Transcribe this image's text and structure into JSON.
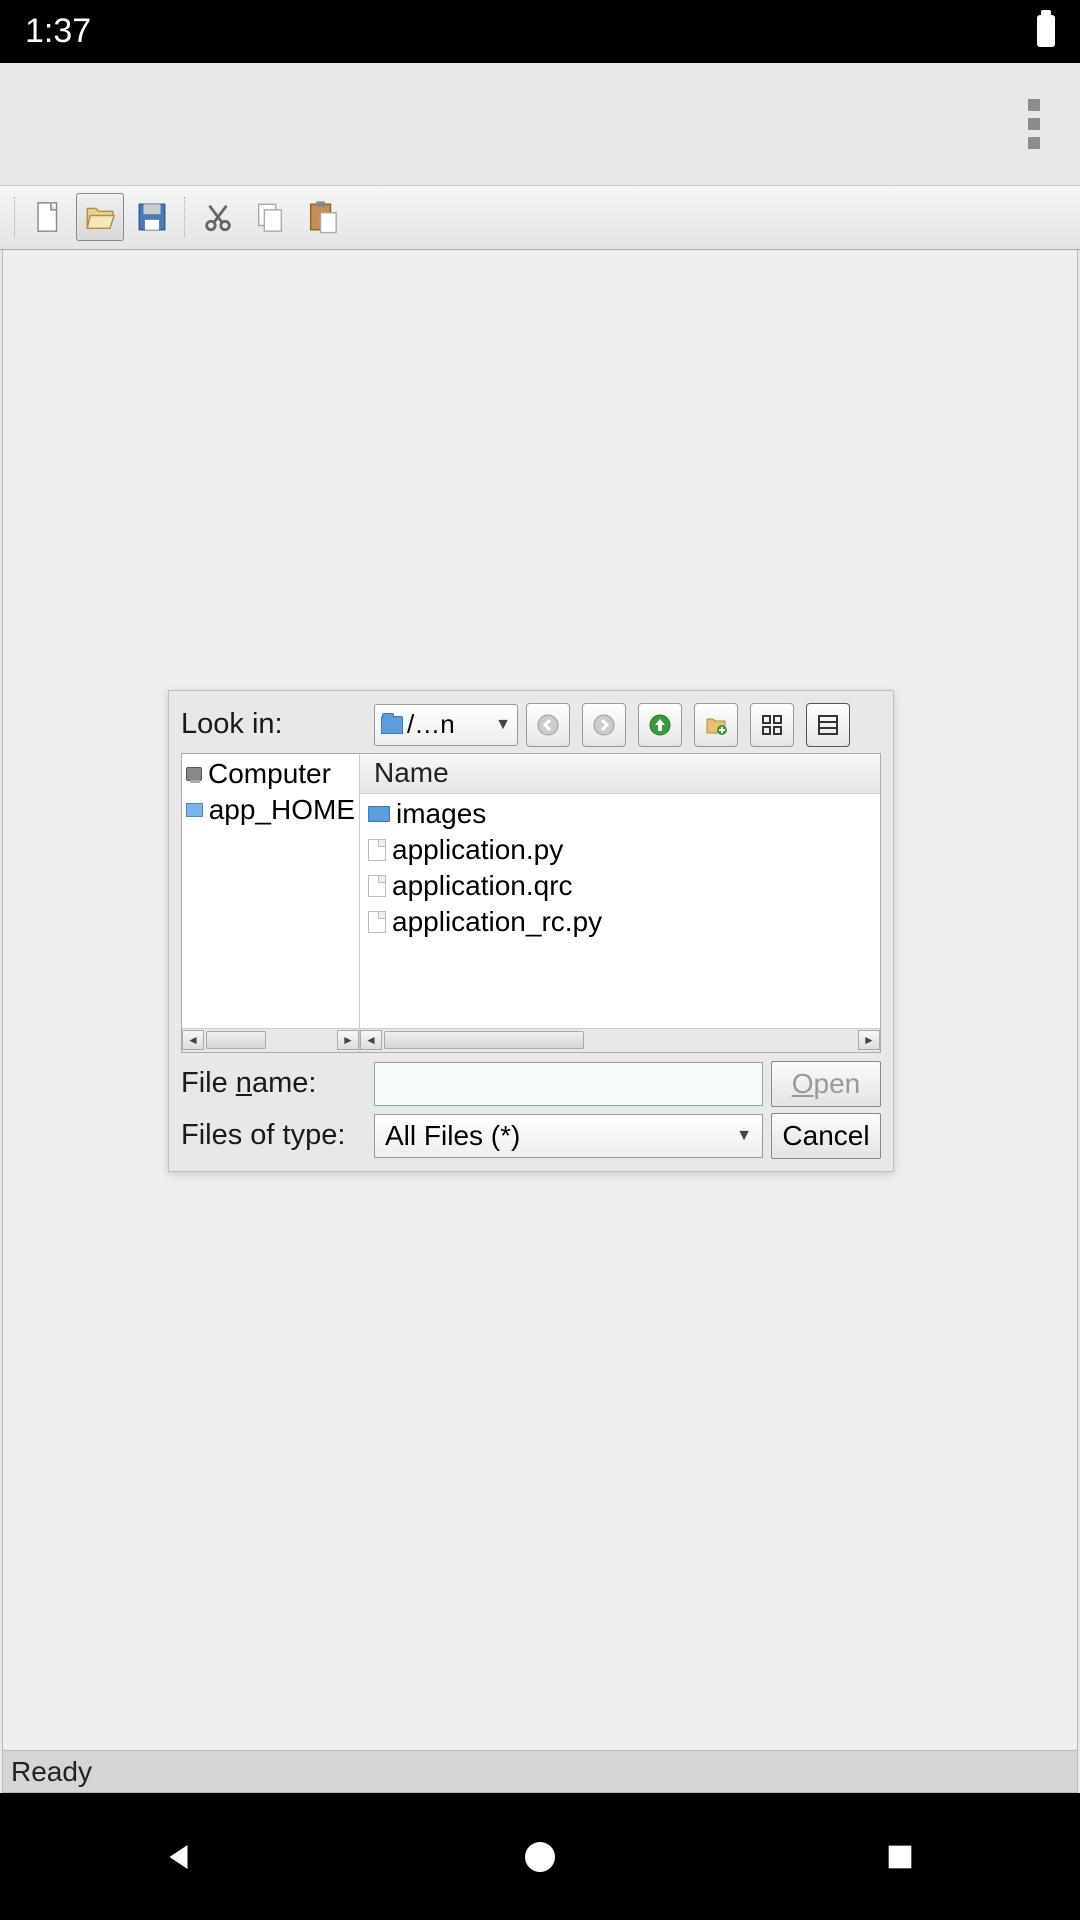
{
  "status_bar": {
    "time": "1:37"
  },
  "toolbar": {
    "buttons": [
      "new",
      "open",
      "save",
      "cut",
      "copy",
      "paste"
    ]
  },
  "dialog": {
    "look_in_label": "Look in:",
    "look_in_value": "/…n",
    "sidebar": [
      "Computer",
      "app_HOME"
    ],
    "column_header": "Name",
    "files": [
      {
        "name": "images",
        "type": "folder"
      },
      {
        "name": "application.py",
        "type": "file"
      },
      {
        "name": "application.qrc",
        "type": "file"
      },
      {
        "name": "application_rc.py",
        "type": "file"
      }
    ],
    "file_name_label_pre": "File ",
    "file_name_label_u": "n",
    "file_name_label_post": "ame:",
    "file_name_value": "",
    "files_of_type_label": "Files of type:",
    "files_of_type_value": "All Files (*)",
    "open_label_u": "O",
    "open_label_post": "pen",
    "cancel_label": "Cancel"
  },
  "status_line": "Ready"
}
